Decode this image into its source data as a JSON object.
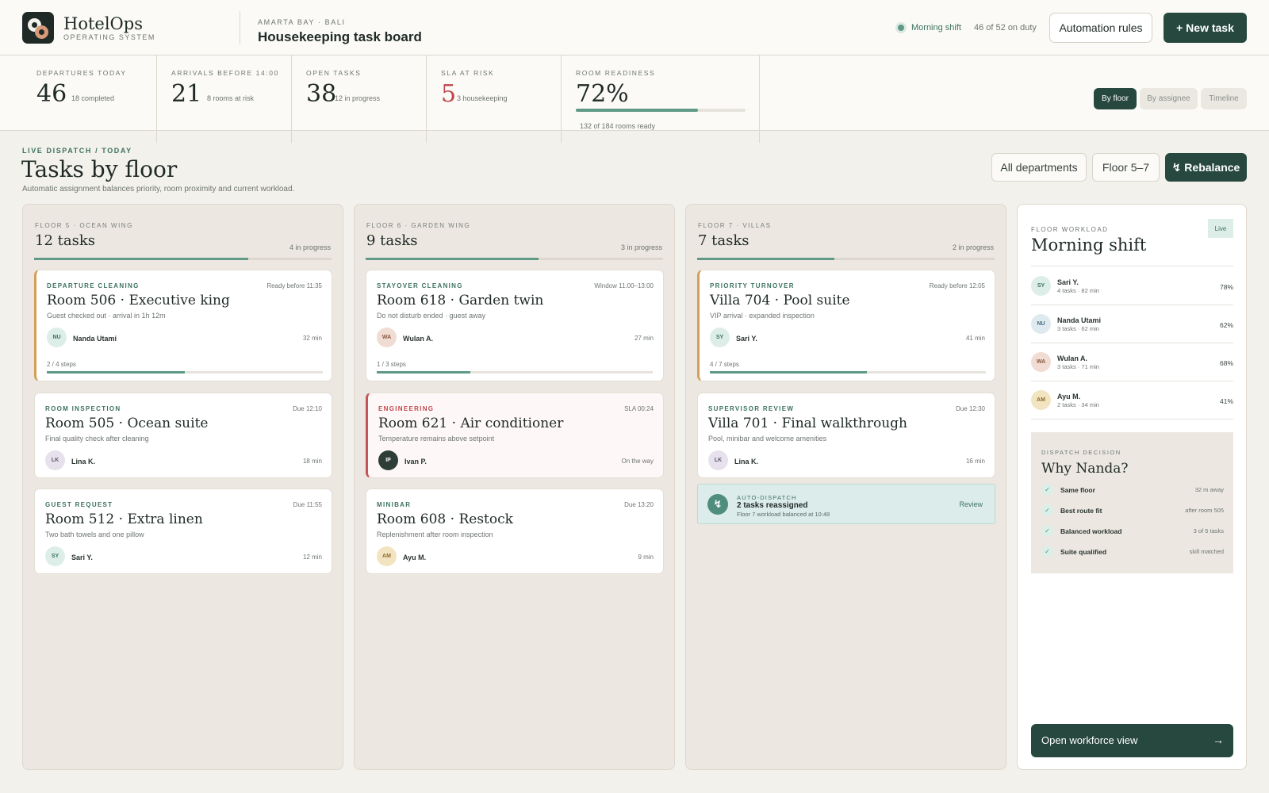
{
  "app": {
    "brand": "HotelOps",
    "brand_sub": "OPERATING SYSTEM",
    "location": "AMARTA BAY · BALI",
    "title": "Housekeeping task board"
  },
  "header": {
    "shift": "Morning shift",
    "duty": "46 of 52 on duty",
    "automation_label": "Automation rules",
    "new_task_label": "+ New task"
  },
  "stats": [
    {
      "label": "DEPARTURES TODAY",
      "value": "46",
      "sub": "18 completed"
    },
    {
      "label": "ARRIVALS BEFORE 14:00",
      "value": "21",
      "sub": "8 rooms at risk"
    },
    {
      "label": "OPEN TASKS",
      "value": "38",
      "sub": "12 in progress"
    },
    {
      "label": "SLA AT RISK",
      "value": "5",
      "sub": "3 housekeeping",
      "color": "#c0464c"
    },
    {
      "label": "ROOM READINESS",
      "value": "72%",
      "note": "132 of 184 rooms ready",
      "progress": 0.72
    }
  ],
  "view_toggle": {
    "active": "By floor",
    "options": [
      "By floor",
      "By assignee",
      "Timeline"
    ]
  },
  "section": {
    "kicker": "LIVE DISPATCH / TODAY",
    "title": "Tasks by floor",
    "subtitle": "Automatic assignment balances priority, room proximity and current workload."
  },
  "filters": {
    "departments": "All departments",
    "floor": "Floor 5–7",
    "rebalance": "↯ Rebalance"
  },
  "columns": [
    {
      "label": "FLOOR 5 · OCEAN WING",
      "count": "12 tasks",
      "progress_text": "4 in progress",
      "progress": 0.72,
      "cards": [
        {
          "type": "DEPARTURE CLEANING",
          "meta": "Ready before 11:35",
          "name": "Room 506 · Executive king",
          "desc": "Guest checked out · arrival in 1h 12m",
          "initials": "NU",
          "assignee": "Nanda Utami",
          "duration": "32 min",
          "steps": "2 / 4 steps",
          "step_progress": 0.5
        },
        {
          "type": "ROOM INSPECTION",
          "meta": "Due 12:10",
          "name": "Room 505 · Ocean suite",
          "desc": "Final quality check after cleaning",
          "initials": "LK",
          "assignee": "Lina K.",
          "duration": "18 min"
        },
        {
          "type": "GUEST REQUEST",
          "meta": "Due 11:55",
          "name": "Room 512 · Extra linen",
          "desc": "Two bath towels and one pillow",
          "initials": "SY",
          "assignee": "Sari Y.",
          "duration": "12 min"
        }
      ]
    },
    {
      "label": "FLOOR 6 · GARDEN WING",
      "count": "9 tasks",
      "progress_text": "3 in progress",
      "progress": 0.58,
      "cards": [
        {
          "type": "STAYOVER CLEANING",
          "meta": "Window 11:00–13:00",
          "name": "Room 618 · Garden twin",
          "desc": "Do not disturb ended · guest away",
          "initials": "WA",
          "assignee": "Wulan A.",
          "duration": "27 min",
          "steps": "1 / 3 steps",
          "step_progress": 0.34
        },
        {
          "type": "ENGINEERING",
          "meta": "SLA 00:24",
          "name": "Room 621 · Air conditioner",
          "desc": "Temperature remains above setpoint",
          "initials": "IP",
          "assignee": "Ivan P.",
          "duration": "On the way"
        },
        {
          "type": "MINIBAR",
          "meta": "Due 13:20",
          "name": "Room 608 · Restock",
          "desc": "Replenishment after room inspection",
          "initials": "AM",
          "assignee": "Ayu M.",
          "duration": "9 min"
        }
      ]
    },
    {
      "label": "FLOOR 7 · VILLAS",
      "count": "7 tasks",
      "progress_text": "2 in progress",
      "progress": 0.46,
      "cards": [
        {
          "type": "PRIORITY TURNOVER",
          "meta": "Ready before 12:05",
          "name": "Villa 704 · Pool suite",
          "desc": "VIP arrival · expanded inspection",
          "initials": "SY",
          "assignee": "Sari Y.",
          "duration": "41 min",
          "steps": "4 / 7 steps",
          "step_progress": 0.57
        },
        {
          "type": "SUPERVISOR REVIEW",
          "meta": "Due 12:30",
          "name": "Villa 701 · Final walkthrough",
          "desc": "Pool, minibar and welcome amenities",
          "initials": "LK",
          "assignee": "Lina K.",
          "duration": "16 min"
        }
      ],
      "auto": {
        "kicker": "AUTO-DISPATCH",
        "message": "2 tasks reassigned",
        "sub": "Floor 7 workload balanced at 10:48",
        "action": "Review",
        "icon": "↯"
      }
    }
  ],
  "workload": {
    "kicker": "FLOOR WORKLOAD",
    "title": "Morning shift",
    "live": "Live",
    "staff": [
      {
        "initials": "SY",
        "name": "Sari Y.",
        "sub": "4 tasks · 82 min",
        "pct": "78%"
      },
      {
        "initials": "NU",
        "name": "Nanda Utami",
        "sub": "3 tasks · 62 min",
        "pct": "62%"
      },
      {
        "initials": "WA",
        "name": "Wulan A.",
        "sub": "3 tasks · 71 min",
        "pct": "68%"
      },
      {
        "initials": "AM",
        "name": "Ayu M.",
        "sub": "2 tasks · 34 min",
        "pct": "41%"
      }
    ],
    "decision": {
      "kicker": "DISPATCH DECISION",
      "title": "Why Nanda?",
      "reasons": [
        {
          "label": "Same floor",
          "value": "32 m away"
        },
        {
          "label": "Best route fit",
          "value": "after room 505"
        },
        {
          "label": "Balanced workload",
          "value": "3 of 5 tasks"
        },
        {
          "label": "Suite qualified",
          "value": "skill matched"
        }
      ]
    },
    "cta": "Open workforce view",
    "cta_arrow": "→"
  }
}
